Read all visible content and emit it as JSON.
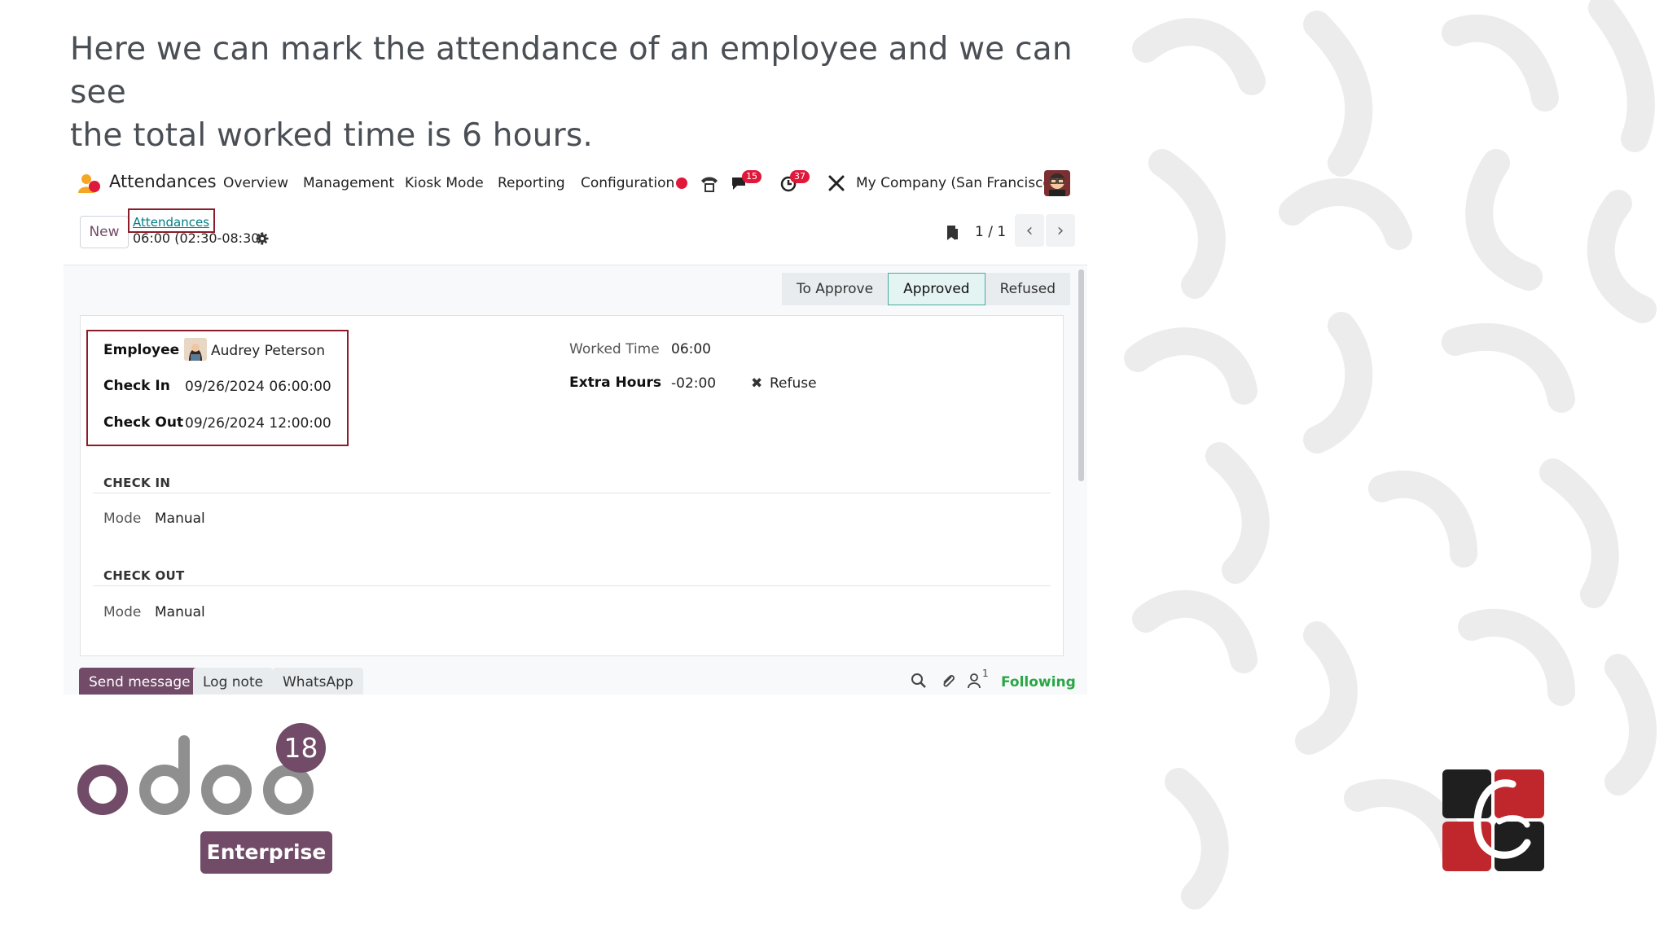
{
  "caption": {
    "line1": "Here we can mark the attendance of an employee and we can see",
    "line2": "the total worked time is 6 hours."
  },
  "navbar": {
    "app_name": "Attendances",
    "menu": [
      "Overview",
      "Management",
      "Kiosk Mode",
      "Reporting",
      "Configuration"
    ],
    "messages_count": "15",
    "activities_count": "37",
    "company": "My Company (San Francisco)"
  },
  "control_panel": {
    "new_label": "New",
    "breadcrumb": "Attendances",
    "record_title": "06:00 (02:30-08:30)",
    "pager": "1 / 1"
  },
  "status_bar": {
    "stages": [
      "To Approve",
      "Approved",
      "Refused"
    ],
    "active": "Approved"
  },
  "form": {
    "employee_label": "Employee",
    "employee_value": "Audrey Peterson",
    "check_in_label": "Check In",
    "check_in_value": "09/26/2024 06:00:00",
    "check_out_label": "Check Out",
    "check_out_value": "09/26/2024 12:00:00",
    "worked_time_label": "Worked Time",
    "worked_time_value": "06:00",
    "extra_hours_label": "Extra Hours",
    "extra_hours_value": "-02:00",
    "refuse_label": "Refuse",
    "section_check_in": "CHECK IN",
    "section_check_out": "CHECK OUT",
    "mode_label": "Mode",
    "check_in_mode": "Manual",
    "check_out_mode": "Manual"
  },
  "chatter": {
    "send_message": "Send message",
    "log_note": "Log note",
    "whatsapp": "WhatsApp",
    "followers_count": "1",
    "following": "Following"
  },
  "branding": {
    "version": "18",
    "edition": "Enterprise"
  },
  "colors": {
    "odoo_purple": "#714b67",
    "highlight_red": "#8c1c2a",
    "badge_red": "#e0183b",
    "following_green": "#28a745"
  }
}
